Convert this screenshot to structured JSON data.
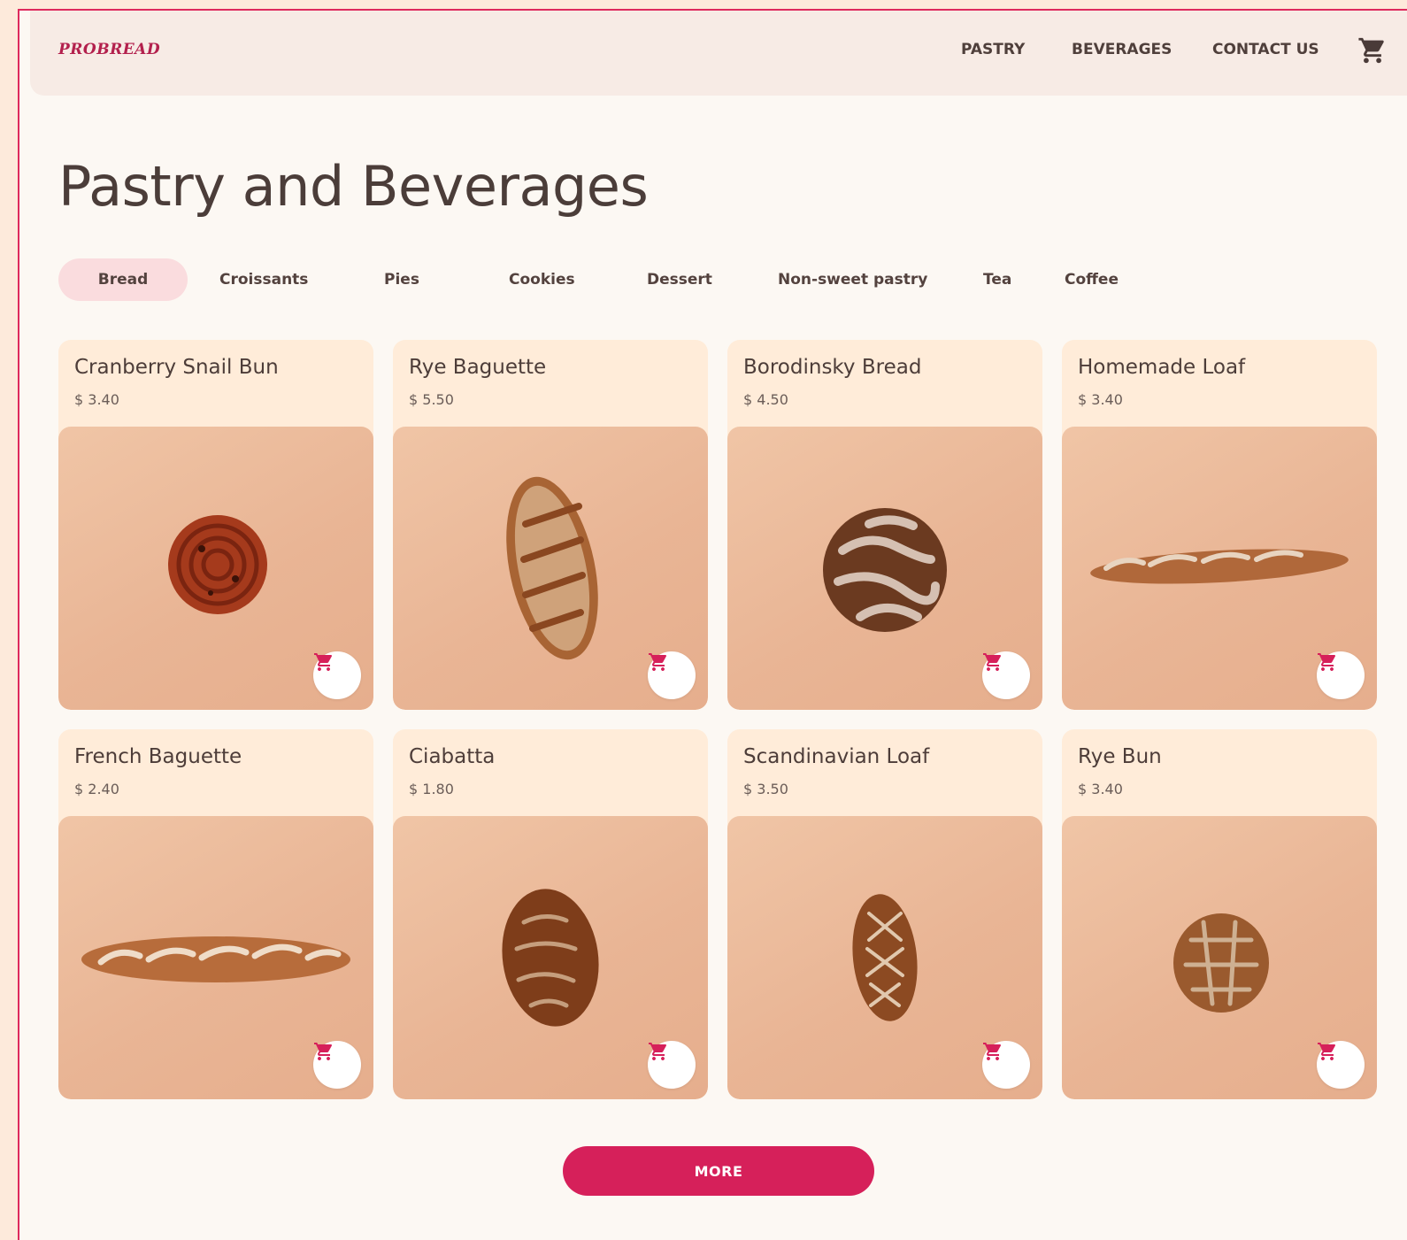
{
  "header": {
    "logo": "PROBREAD",
    "nav": [
      "PASTRY",
      "BEVERAGES",
      "CONTACT US"
    ],
    "cart_icon": "cart-icon"
  },
  "page": {
    "title": "Pastry and Beverages"
  },
  "tabs": [
    {
      "label": "Bread",
      "active": true
    },
    {
      "label": "Croissants",
      "active": false
    },
    {
      "label": "Pies",
      "active": false
    },
    {
      "label": "Cookies",
      "active": false
    },
    {
      "label": "Dessert",
      "active": false
    },
    {
      "label": "Non-sweet pastry",
      "active": false
    },
    {
      "label": "Tea",
      "active": false
    },
    {
      "label": "Coffee",
      "active": false
    }
  ],
  "products": [
    {
      "name": "Cranberry Snail Bun",
      "price": "$ 3.40"
    },
    {
      "name": "Rye Baguette",
      "price": "$ 5.50"
    },
    {
      "name": "Borodinsky Bread",
      "price": "$ 4.50"
    },
    {
      "name": "Homemade Loaf",
      "price": "$ 3.40"
    },
    {
      "name": "French Baguette",
      "price": "$ 2.40"
    },
    {
      "name": "Ciabatta",
      "price": "$ 1.80"
    },
    {
      "name": "Scandinavian Loaf",
      "price": "$ 3.50"
    },
    {
      "name": "Rye Bun",
      "price": "$ 3.40"
    }
  ],
  "more_button": "MORE",
  "colors": {
    "accent": "#d6205a",
    "tab_active_bg": "#fadcde",
    "card_bg": "#ffecd9",
    "image_bg": "#ebb899",
    "page_bg": "#fcf8f3",
    "nav_bg": "#f7ebe5"
  }
}
